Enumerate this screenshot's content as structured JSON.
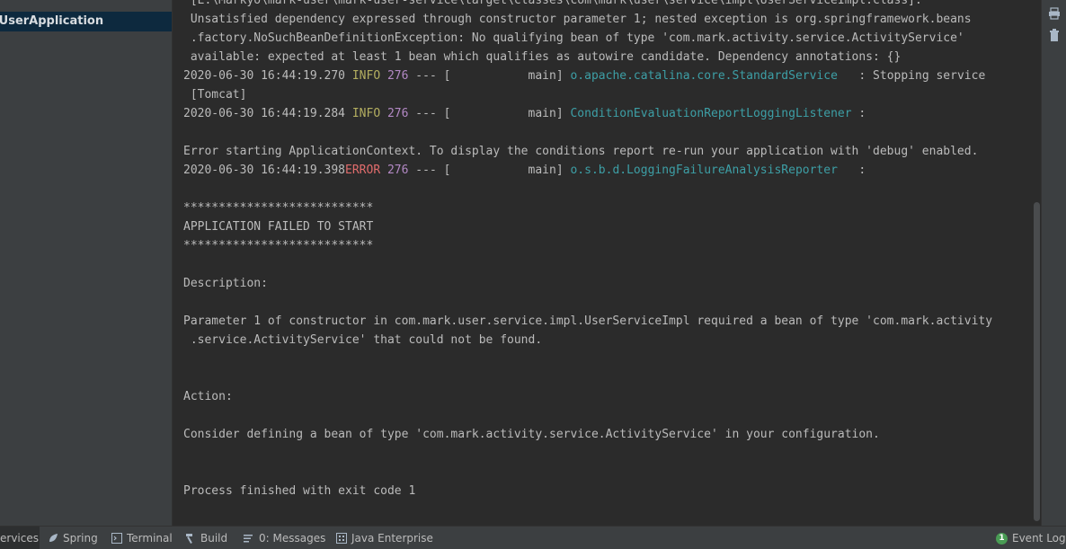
{
  "sidebar": {
    "selected_item": "kUserApplication"
  },
  "console": {
    "lines": [
      " [E:\\Markyo\\mark-user\\mark-user-service\\target\\classes\\com\\mark\\user\\service\\impl\\UserServiceImpl.class]:",
      " Unsatisfied dependency expressed through constructor parameter 1; nested exception is org.springframework.beans",
      " .factory.NoSuchBeanDefinitionException: No qualifying bean of type 'com.mark.activity.service.ActivityService'",
      " available: expected at least 1 bean which qualifies as autowire candidate. Dependency annotations: {}",
      {
        "ts": "2020-06-30 16:44:19.270",
        "level": " INFO",
        "pid": "276",
        "sep": " --- [           main] ",
        "logger": "o.apache.catalina.core.StandardService  ",
        "msg": " : Stopping service"
      },
      " [Tomcat]",
      {
        "ts": "2020-06-30 16:44:19.284",
        "level": " INFO",
        "pid": "276",
        "sep": " --- [           main] ",
        "logger": "ConditionEvaluationReportLoggingListener",
        "msg": " :"
      },
      "",
      "Error starting ApplicationContext. To display the conditions report re-run your application with 'debug' enabled.",
      {
        "ts": "2020-06-30 16:44:19.398",
        "level": "ERROR",
        "pid": "276",
        "sep": " --- [           main] ",
        "logger": "o.s.b.d.LoggingFailureAnalysisReporter  ",
        "msg": " :"
      },
      "",
      "***************************",
      "APPLICATION FAILED TO START",
      "***************************",
      "",
      "Description:",
      "",
      "Parameter 1 of constructor in com.mark.user.service.impl.UserServiceImpl required a bean of type 'com.mark.activity",
      " .service.ActivityService' that could not be found.",
      "",
      "",
      "Action:",
      "",
      "Consider defining a bean of type 'com.mark.activity.service.ActivityService' in your configuration.",
      "",
      "",
      "Process finished with exit code 1"
    ]
  },
  "gutter": {
    "icons": [
      "print-icon",
      "trash-icon"
    ]
  },
  "statusbar": {
    "tabs": [
      {
        "label": "ervices",
        "icon": "services-icon",
        "active": true
      },
      {
        "label": "Spring",
        "icon": "spring-leaf-icon",
        "active": false
      },
      {
        "label": "Terminal",
        "icon": "terminal-icon",
        "active": false
      },
      {
        "label": "Build",
        "icon": "hammer-icon",
        "active": false
      },
      {
        "label": "0: Messages",
        "icon": "messages-icon",
        "active": false
      },
      {
        "label": "Java Enterprise",
        "icon": "java-enterprise-icon",
        "active": false
      }
    ],
    "event_log": {
      "label": "Event Log",
      "count": "1"
    }
  }
}
